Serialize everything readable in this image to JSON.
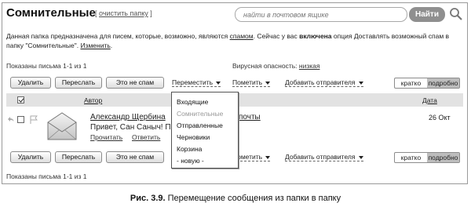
{
  "header": {
    "title": "Сомнительные",
    "clear_folder": "очистить папку",
    "search_placeholder": "найти в почтовом ящике",
    "search_button": "Найти"
  },
  "description": {
    "part1": "Данная папка предназначена для писем, которые, возможно, являются ",
    "spam_link": "спамом",
    "part2": ". Сейчас у вас ",
    "enabled": "включена",
    "part3": " опция Доставлять возможный спам в папку \"Сомнительные\". ",
    "change_link": "Изменить",
    "part4": "."
  },
  "list_info": {
    "shown_top": "Показаны письма 1-1 из 1",
    "shown_bottom": "Показаны письма 1-1 из 1",
    "virus_label": "Вирусная опасность: ",
    "virus_value": "низкая"
  },
  "toolbar": {
    "delete": "Удалить",
    "forward": "Переслать",
    "not_spam": "Это не спам",
    "move": "Переместить",
    "mark": "Пометить",
    "add_sender": "Добавить отправителя",
    "view_brief": "кратко",
    "view_detailed": "подробно"
  },
  "columns": {
    "author": "Автор",
    "date": "Дата"
  },
  "message": {
    "sender": "Александр Щербина",
    "subject": "Привет, Сан Саныч! Про",
    "subject_tail": "почты",
    "read": "Прочитать",
    "reply": "Ответить",
    "date": "26 Окт"
  },
  "move_menu": {
    "items": [
      "Входящие",
      "Сомнительные",
      "Отправленные",
      "Черновики",
      "Корзина",
      "- новую -"
    ]
  },
  "caption": {
    "label": "Рис. 3.9.",
    "text": " Перемещение сообщения из папки в папку"
  }
}
